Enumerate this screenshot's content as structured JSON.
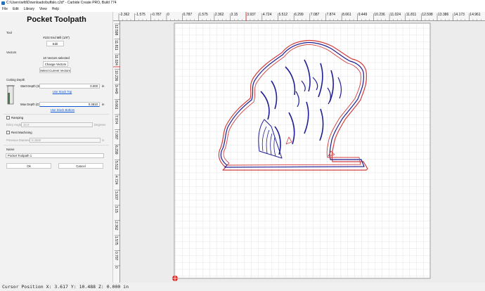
{
  "window": {
    "title": "C:\\Users\\wfd\\Downloads\\buffalo.c2d* - Carbide Create PRO, Build 774"
  },
  "menu": [
    "File",
    "Edit",
    "Library",
    "View",
    "Help"
  ],
  "panel": {
    "title": "Pocket Toolpath",
    "tool": {
      "section": "Tool",
      "name": "#102 End Mill (1/8\")",
      "edit_label": "Edit"
    },
    "vectors": {
      "section": "Vectors",
      "selected_text": "10 Vectors selected",
      "change_label": "Change Vectors",
      "select_current_label": "Select Current Vectors"
    },
    "cutting_depth": {
      "section": "Cutting Depth",
      "start_label": "Start Depth (S)",
      "start_value": "0.000",
      "start_unit": "in",
      "use_stock_top": "Use Stock Top",
      "max_label": "Max Depth (D)",
      "max_value": "0.3810",
      "max_unit": "in",
      "use_stock_bottom": "Use Stock Bottom"
    },
    "ramping": {
      "label": "Ramping",
      "checked": false,
      "entry_angle_label": "Entry Angle",
      "entry_angle_value": "10.0",
      "entry_angle_unit": "Degrees"
    },
    "rest_machining": {
      "label": "Rest Machining",
      "checked": false,
      "prev_diameter_label": "Previous Diameter",
      "prev_diameter_value": "0.2500",
      "prev_diameter_unit": "in"
    },
    "name": {
      "section": "Name",
      "value": "Pocket Toolpath 1"
    },
    "ok_label": "Ok",
    "cancel_label": "Cancel"
  },
  "ruler_x": [
    "-2.362",
    "-1.575",
    "-0.787",
    "0",
    "0.787",
    "1.575",
    "2.362",
    "3.15",
    "3.937",
    "4.724",
    "5.512",
    "6.299",
    "7.087",
    "7.874",
    "8.661",
    "9.449",
    "10.236",
    "11.024",
    "11.811",
    "12.598",
    "13.386",
    "14.173",
    "14.961"
  ],
  "ruler_y": [
    "12.598",
    "11.811",
    "11.024",
    "10.236",
    "9.449",
    "8.661",
    "7.874",
    "7.087",
    "6.299",
    "5.512",
    "4.724",
    "3.937",
    "3.15",
    "2.362",
    "1.575",
    "0.787",
    "0"
  ],
  "status": {
    "cursor_text": "Cursor Position X: 3.617 Y: 10.488 Z: 0.000 in"
  }
}
